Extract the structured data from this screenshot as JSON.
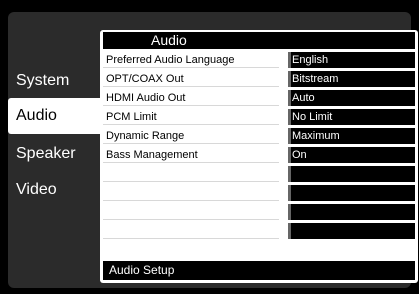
{
  "sidebar": {
    "items": [
      {
        "label": "System",
        "active": false
      },
      {
        "label": "Audio",
        "active": true
      },
      {
        "label": "Speaker",
        "active": false
      },
      {
        "label": "Video",
        "active": false
      }
    ]
  },
  "panel": {
    "title": "Audio",
    "rows": [
      {
        "label": "Preferred Audio Language",
        "value": "English"
      },
      {
        "label": "OPT/COAX Out",
        "value": "Bitstream"
      },
      {
        "label": "HDMI Audio Out",
        "value": "Auto"
      },
      {
        "label": "PCM Limit",
        "value": "No Limit"
      },
      {
        "label": "Dynamic Range",
        "value": "Maximum"
      },
      {
        "label": "Bass Management",
        "value": "On"
      },
      {
        "label": "",
        "value": ""
      },
      {
        "label": "",
        "value": ""
      },
      {
        "label": "",
        "value": ""
      },
      {
        "label": "",
        "value": ""
      }
    ],
    "footer": "Audio Setup"
  },
  "colors": {
    "background": "#000000",
    "screen": "#2b2b2b",
    "panel": "#ffffff",
    "value_cell": "#000000"
  }
}
